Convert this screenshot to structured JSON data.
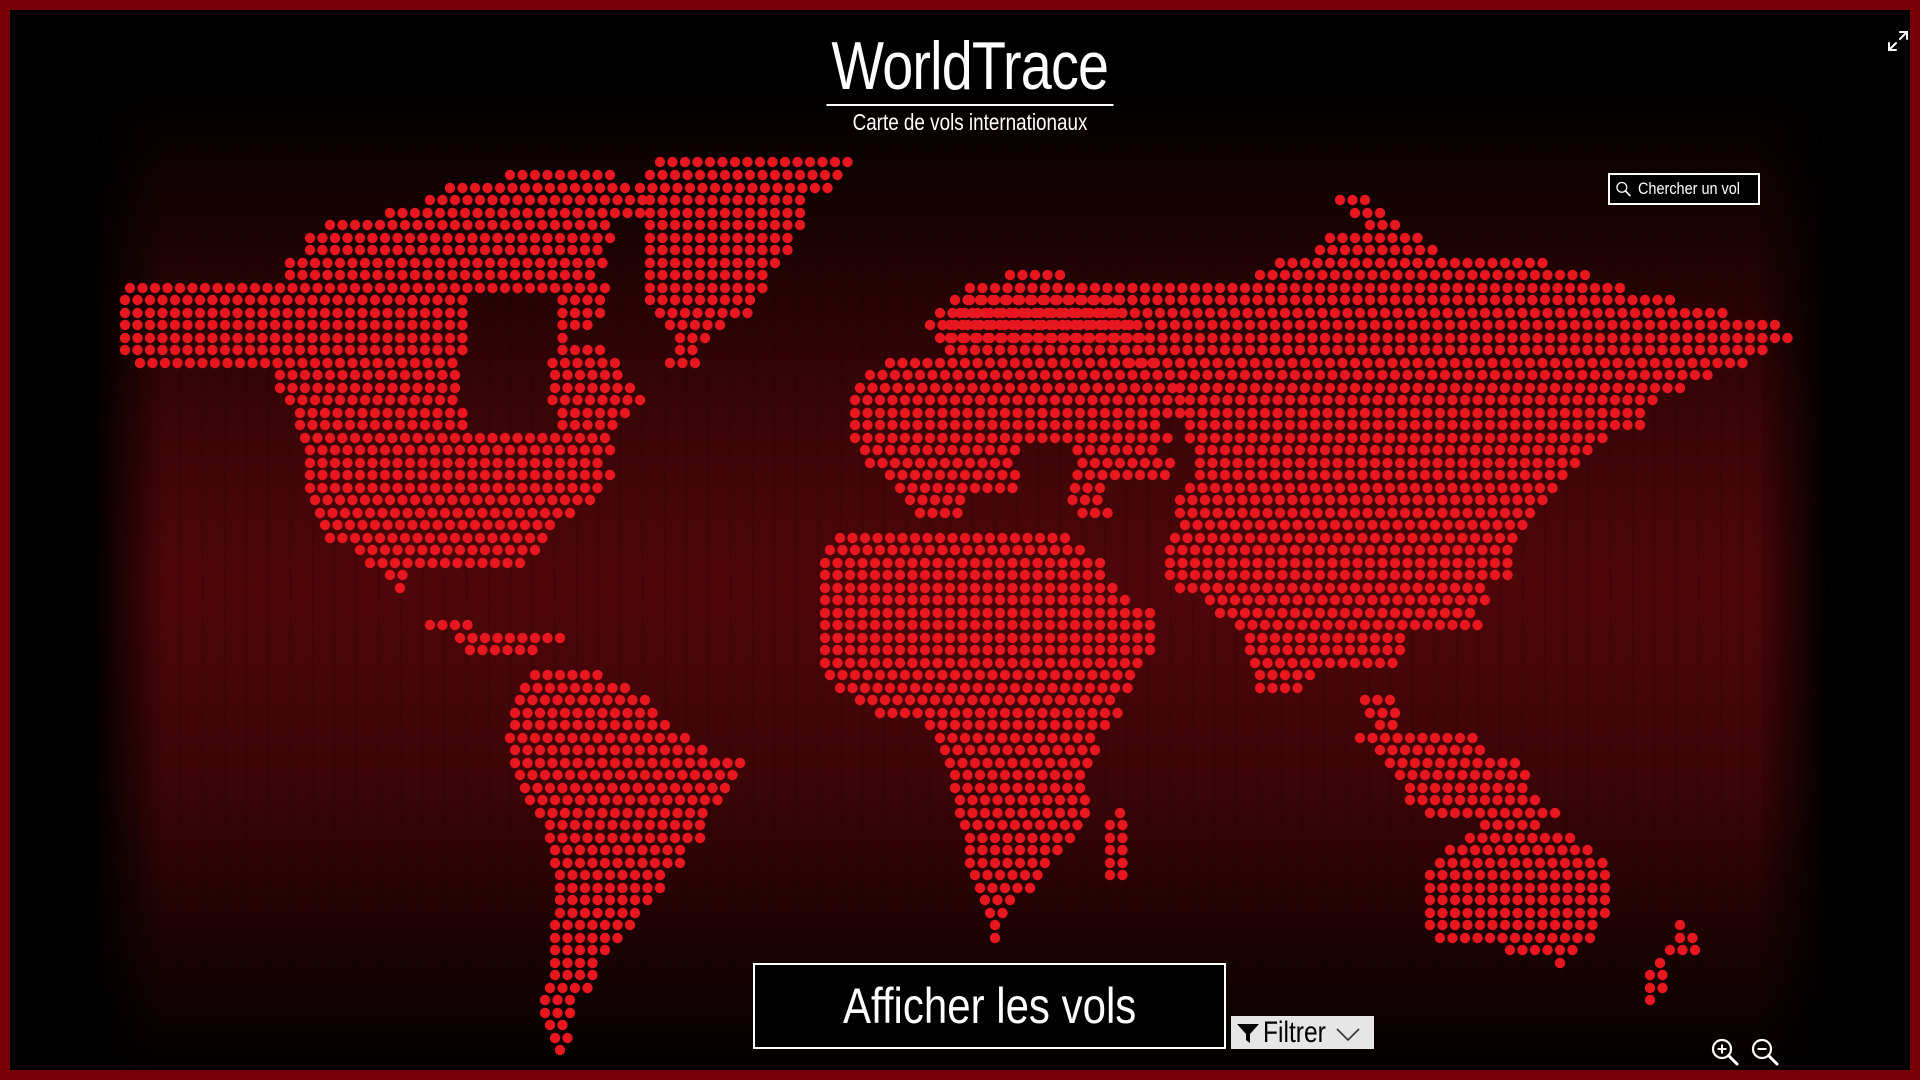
{
  "app": {
    "title": "WorldTrace",
    "subtitle": "Carte de vols internationaux"
  },
  "search": {
    "placeholder": "Chercher un vol",
    "icon": "search-icon"
  },
  "map": {
    "dot_color": "#e8161e",
    "description_icon": "world-dot-map"
  },
  "actions": {
    "show_flights_label": "Afficher les vols",
    "filter_label": "Filtrer",
    "filter_icon": "funnel-icon",
    "filter_chevron": "chevron-down-icon"
  },
  "controls": {
    "fullscreen_icon": "expand-icon",
    "zoom_in_icon": "zoom-in-icon",
    "zoom_out_icon": "zoom-out-icon"
  },
  "colors": {
    "frame_border": "#7a0008",
    "background": "#000000",
    "accent_red": "#e8161e"
  }
}
